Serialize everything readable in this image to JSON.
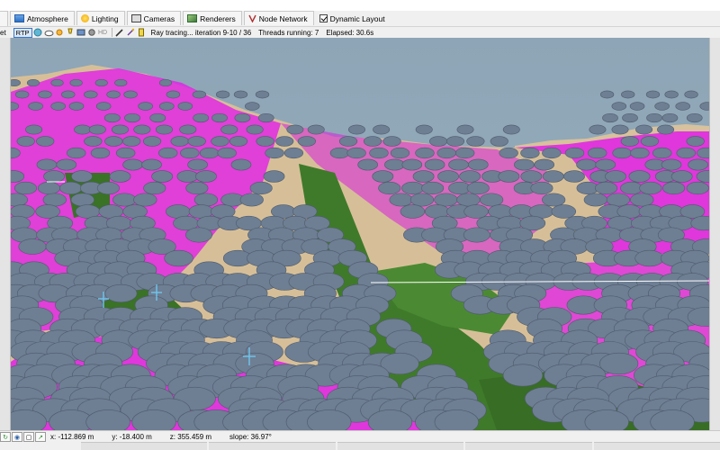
{
  "tabs": [
    {
      "label": "Atmosphere",
      "icon": "atmosphere-icon"
    },
    {
      "label": "Lighting",
      "icon": "sun-icon"
    },
    {
      "label": "Cameras",
      "icon": "camera-icon"
    },
    {
      "label": "Renderers",
      "icon": "renderer-icon"
    },
    {
      "label": "Node Network",
      "icon": "node-network-icon"
    }
  ],
  "dynamic_layout": {
    "label": "Dynamic Layout",
    "checked": true
  },
  "toolbar": {
    "partial_label": "et",
    "rtp_label": "RTP",
    "hd_label": "HD",
    "render_status": "Ray tracing... iteration 9-10 / 36",
    "threads": "Threads running: 7",
    "elapsed": "Elapsed: 30.6s"
  },
  "status": {
    "x": "x: -112.869 m",
    "y": "y: -18.400 m",
    "z": "z: 355.459 m",
    "slope": "slope: 36.97°"
  },
  "colors": {
    "sky": "#8fa6b7",
    "moss": "#ee1ef0",
    "rock": "#d8c19d",
    "grass": "#3f7a2a",
    "shrub": "#6e7e93"
  }
}
